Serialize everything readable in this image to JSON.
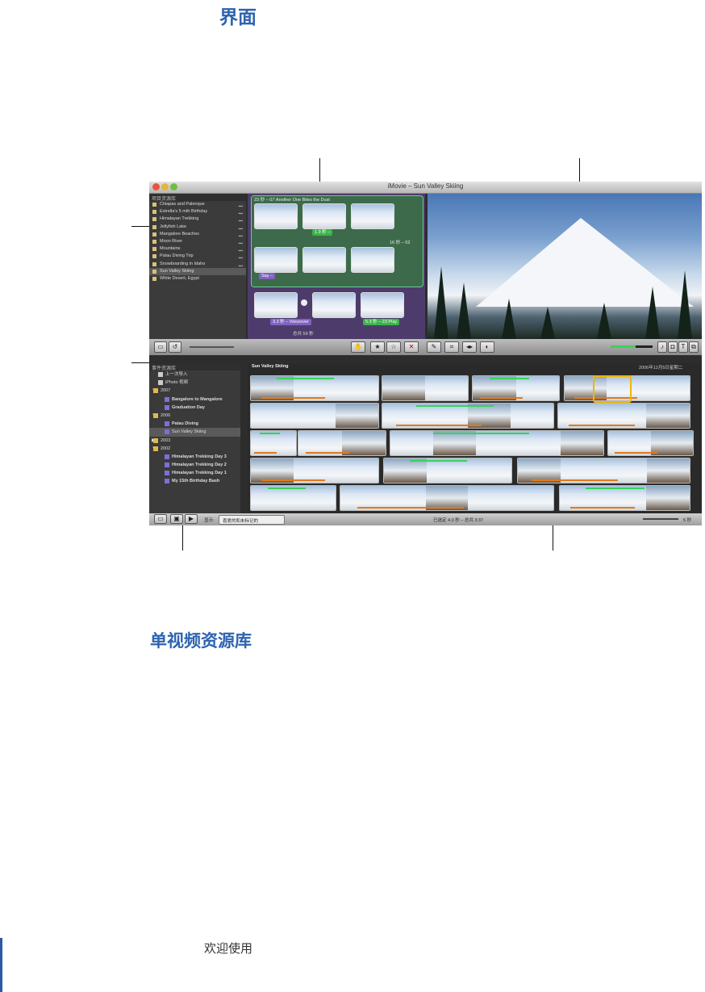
{
  "headings": {
    "interface": "界面",
    "single_library": "单视频资源库"
  },
  "footer": {
    "text": "欢迎使用"
  },
  "window": {
    "title": "iMovie – Sun Valley Skiing",
    "project_library": {
      "header": "项目资源库",
      "projects": [
        {
          "name": "Chiapas and Palenque"
        },
        {
          "name": "Estrella's 5 mth Birthday"
        },
        {
          "name": "Himalayan Trekking"
        },
        {
          "name": "Jellyfish Lake"
        },
        {
          "name": "Mangalore Beaches"
        },
        {
          "name": "Moon River"
        },
        {
          "name": "Mountains"
        },
        {
          "name": "Palau Diving Trip"
        },
        {
          "name": "Snowboarding in Idaho"
        },
        {
          "name": "Sun Valley Skiing",
          "selected": true
        },
        {
          "name": "White Desert, Egypt"
        }
      ],
      "total": "总共 59 秒"
    },
    "project_browser": {
      "title_bar": "23 秒 – 07 Another One Bites the Dust",
      "clip_label_1": "1.9 秒 –",
      "clip_label_2": "16 秒 – 02",
      "clip_label_3": "Say –",
      "voiceover": "3.3 秒 – Voiceover",
      "play": "5.3 秒 – 23 Play"
    },
    "event_library": {
      "header": "事件资源库",
      "items": [
        {
          "label": "上一次导入",
          "level": 1,
          "kind": "import"
        },
        {
          "label": "iPhoto 视频",
          "level": 1,
          "kind": "iphoto"
        },
        {
          "label": "2007",
          "level": 0,
          "kind": "year",
          "expanded": true
        },
        {
          "label": "Bangalore to Mangalore",
          "level": 2,
          "kind": "event"
        },
        {
          "label": "Graduation Day",
          "level": 2,
          "kind": "event"
        },
        {
          "label": "2006",
          "level": 0,
          "kind": "year",
          "expanded": true
        },
        {
          "label": "Palau Diving",
          "level": 2,
          "kind": "event"
        },
        {
          "label": "Sun Valley Skiing",
          "level": 2,
          "kind": "event",
          "selected": true
        },
        {
          "label": "2003",
          "level": 0,
          "kind": "year",
          "expanded": false
        },
        {
          "label": "2002",
          "level": 0,
          "kind": "year",
          "expanded": true
        },
        {
          "label": "Himalayan Trekking Day 3",
          "level": 2,
          "kind": "event"
        },
        {
          "label": "Himalayan Trekking Day 2",
          "level": 2,
          "kind": "event"
        },
        {
          "label": "Himalayan Trekking Day 1",
          "level": 2,
          "kind": "event"
        },
        {
          "label": "My 15th Birthday Bash",
          "level": 2,
          "kind": "event"
        }
      ]
    },
    "event_browser": {
      "title": "Sun Valley Skiing",
      "date": "2006年12月5日星期二"
    },
    "bottom_bar": {
      "show_label": "显示:",
      "show_value": "喜爱的和未标记的",
      "status": "已选定 4.0 秒 – 总共 3:37",
      "zoom": "5 秒"
    },
    "mid_buttons": {
      "favorite": "★",
      "unmark": "☆",
      "reject": "✕"
    }
  },
  "colors": {
    "heading": "#2e63b0",
    "selection": "#f0b400",
    "audio_green": "#37d45a",
    "orange_line": "#e07a20"
  }
}
